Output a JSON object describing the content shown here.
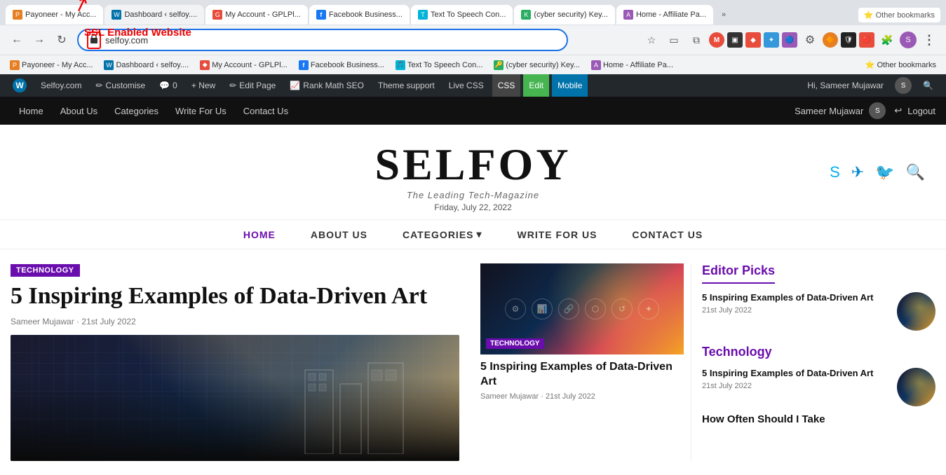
{
  "browser": {
    "url": "selfoy.com",
    "tabs": [
      {
        "label": "Payoneer - My Acc...",
        "favicon_color": "#e67e22",
        "active": false
      },
      {
        "label": "Dashboard ‹ selfoy....",
        "favicon_color": "#0073aa",
        "active": false
      },
      {
        "label": "My Account - GPLPl...",
        "favicon_color": "#e74c3c",
        "active": false
      },
      {
        "label": "Facebook Business...",
        "favicon_color": "#1877f2",
        "active": false
      },
      {
        "label": "Text To Speech Con...",
        "favicon_color": "#00b4d8",
        "active": false
      },
      {
        "label": "(cyber security) Key...",
        "favicon_color": "#27ae60",
        "active": false
      },
      {
        "label": "Home - Affiliate Pa...",
        "favicon_color": "#9b59b6",
        "active": false
      }
    ],
    "bookmarks": [
      {
        "label": "Payoneer - My Acc...",
        "icon": "P"
      },
      {
        "label": "Dashboard ‹ selfoy....",
        "icon": "W"
      },
      {
        "label": "My Account - GPLPl...",
        "icon": "G"
      },
      {
        "label": "Facebook Business...",
        "icon": "f"
      },
      {
        "label": "Text To Speech Con...",
        "icon": "T"
      },
      {
        "label": "(cyber security) Key...",
        "icon": "K"
      },
      {
        "label": "Home - Affiliate Pa...",
        "icon": "A"
      }
    ],
    "other_bookmarks_label": "Other bookmarks"
  },
  "wp_admin_bar": {
    "items": [
      {
        "label": "W",
        "type": "logo"
      },
      {
        "label": "Selfoy.com",
        "type": "normal"
      },
      {
        "label": "Customise",
        "type": "normal",
        "icon": "✏️"
      },
      {
        "label": "0",
        "type": "normal",
        "icon": "💬"
      },
      {
        "label": "+ New",
        "type": "normal"
      },
      {
        "label": "Edit Page",
        "type": "normal",
        "icon": "✏️"
      },
      {
        "label": "Rank Math SEO",
        "type": "normal",
        "icon": "📊"
      },
      {
        "label": "Theme support",
        "type": "normal"
      },
      {
        "label": "Live CSS",
        "type": "normal"
      },
      {
        "label": "CSS",
        "type": "highlight_dark"
      },
      {
        "label": "Edit",
        "type": "highlight_green"
      },
      {
        "label": "Mobile",
        "type": "highlight_blue"
      }
    ],
    "right": {
      "greeting": "Hi, Sameer Mujawar"
    }
  },
  "site_nav": {
    "items": [
      {
        "label": "Home"
      },
      {
        "label": "About Us"
      },
      {
        "label": "Categories"
      },
      {
        "label": "Write For Us"
      },
      {
        "label": "Contact Us"
      }
    ],
    "user": "Sameer Mujawar",
    "logout": "Logout"
  },
  "ssl_annotation": {
    "text": "SSL Enabled Website"
  },
  "site_header": {
    "logo": "SELFOY",
    "tagline": "The Leading Tech-Magazine",
    "date": "Friday, July 22, 2022",
    "icons": [
      "skype",
      "telegram",
      "twitter",
      "search"
    ]
  },
  "main_nav": {
    "items": [
      {
        "label": "HOME",
        "active": true
      },
      {
        "label": "ABOUT US",
        "active": false
      },
      {
        "label": "CATEGORIES",
        "active": false,
        "has_dropdown": true
      },
      {
        "label": "WRITE FOR US",
        "active": false
      },
      {
        "label": "CONTACT US",
        "active": false
      }
    ]
  },
  "main_article": {
    "category": "TECHNOLOGY",
    "title": "5 Inspiring Examples of Data-Driven Art",
    "author": "Sameer Mujawar",
    "date": "21st July 2022"
  },
  "secondary_article": {
    "category": "TECHNOLOGY",
    "title": "5 Inspiring Examples of Data-Driven Art",
    "author": "Sameer Mujawar",
    "date": "21st July 2022"
  },
  "sidebar": {
    "editor_picks_title": "Editor Picks",
    "editor_picks": [
      {
        "title": "5 Inspiring Examples of Data-Driven Art",
        "date": "21st July 2022"
      }
    ],
    "technology_title": "Technology",
    "technology_articles": [
      {
        "title": "5 Inspiring Examples of Data-Driven Art",
        "date": "21st July 2022"
      }
    ],
    "last_item_title": "How Often Should I Take"
  }
}
